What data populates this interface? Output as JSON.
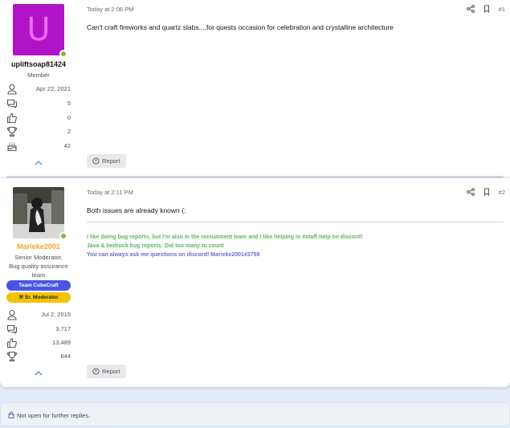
{
  "posts": [
    {
      "avatar_letter": "U",
      "username": "upliftsoap81424",
      "user_title": "Member",
      "stats": {
        "joined": "Apr 22, 2021",
        "messages": "5",
        "reactions": "0",
        "points": "2",
        "age": "42"
      },
      "date": "Today at 2:06 PM",
      "number": "#1",
      "body": "Can't craft fireworks and quartz slabs....for quests occasion for celebration and crystalline architecture",
      "report_label": "Report"
    },
    {
      "username": "Marieke2001",
      "user_title_lines": [
        "Senior Moderator,",
        "Bug quality assurance",
        "team"
      ],
      "banners": [
        "Team CubeCraft",
        "Sr. Moderator"
      ],
      "stats": {
        "joined": "Jul 2, 2015",
        "messages": "3,717",
        "reactions": "13,489",
        "points": "644"
      },
      "date": "Today at 2:11 PM",
      "number": "#2",
      "body": "Both issues are already known (:",
      "signature": [
        "I like doing bug reports, but i'm also in the recruitment team and I like helping in #staff-help on discord!",
        "Java & bedrock bug reports: Did too many to count",
        "You can always ask me questions on discord! Marieke2001#3759"
      ],
      "report_label": "Report"
    }
  ],
  "footer": {
    "text": "Not open for further replies."
  },
  "colors": {
    "avatar_bg": "#b114c7",
    "online": "#7fba3f",
    "mod_name": "#f5a623",
    "banner_team": "#4a56e2",
    "banner_mod": "#f5c400",
    "sig_green": "#5cb85c",
    "sig_blue": "#6b6fd0"
  },
  "icons": [
    "share-icon",
    "bookmark-icon",
    "user-icon",
    "messages-icon",
    "thumbs-up-icon",
    "trophy-icon",
    "cake-icon",
    "chevron-up-icon",
    "report-icon",
    "lock-icon"
  ]
}
